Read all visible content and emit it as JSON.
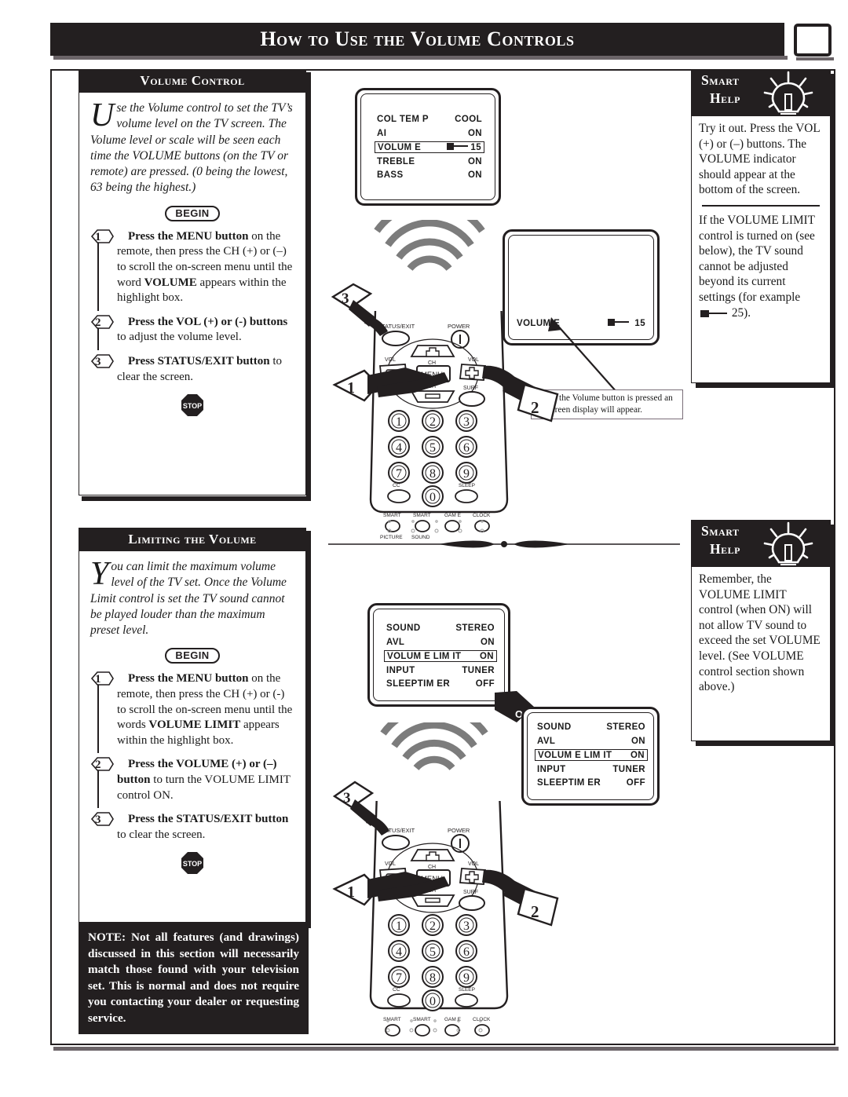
{
  "page": {
    "title": "How to Use the Volume Controls",
    "corner_icon": "tv-icon"
  },
  "volume_control": {
    "heading": "Volume Control",
    "dropcap": "U",
    "intro": "se the Volume control to set the TV’s volume level on the TV screen. The Volume level or scale will be seen each time the VOLUME buttons (on the TV or remote) are pressed.  (0 being the lowest, 63 being the highest.)",
    "begin_label": "BEGIN",
    "stop_label": "STOP",
    "steps": [
      {
        "num": "1",
        "bold": "Press the MENU button",
        "rest": " on the remote, then press the CH (+) or (–) to scroll the on-screen menu until the word ",
        "bold2": "VOLUME",
        "rest2": " appears within the highlight box."
      },
      {
        "num": "2",
        "bold": "Press the VOL (+) or (-) buttons",
        "rest": " to adjust the volume level.",
        "bold2": "",
        "rest2": ""
      },
      {
        "num": "3",
        "bold": "Press STATUS/EXIT button",
        "rest": " to clear the screen.",
        "bold2": "",
        "rest2": ""
      }
    ]
  },
  "limiting_volume": {
    "heading": "Limiting the Volume",
    "dropcap": "Y",
    "intro": "ou can limit the maximum volume level of the TV set. Once the Volume Limit control is set the TV sound cannot be played louder than the maximum preset level.",
    "begin_label": "BEGIN",
    "stop_label": "STOP",
    "steps": [
      {
        "num": "1",
        "bold": "Press the MENU button",
        "rest": " on the remote, then press the CH (+) or (-) to scroll the on-screen menu until the words ",
        "bold2": "VOLUME LIMIT",
        "rest2": " appears within the highlight box."
      },
      {
        "num": "2",
        "bold": "Press the VOLUME (+) or (–) button",
        "rest": " to turn the VOLUME LIMIT control ON.",
        "bold2": "",
        "rest2": ""
      },
      {
        "num": "3",
        "bold": "Press the STATUS/EXIT button",
        "rest": " to clear the screen.",
        "bold2": "",
        "rest2": ""
      }
    ]
  },
  "note": {
    "text": "NOTE: Not all features (and  drawings) discussed in this section will necessarily match those found with your television set. This is normal and does not require you contacting your dealer or requesting service."
  },
  "smart_help_1": {
    "word1": "Smart",
    "word2": "Help",
    "icon": "lightbulb-icon",
    "para1": "Try it out. Press the VOL (+) or (–) buttons. The VOLUME indicator should appear at the bottom of the screen.",
    "para2_a": "If the VOLUME LIMIT control is turned on (see below), the TV sound cannot be adjusted beyond its current settings (for example ",
    "para2_b": " 25)."
  },
  "smart_help_2": {
    "word1": "Smart",
    "word2": "Help",
    "icon": "lightbulb-icon",
    "para1": "Remember, the VOLUME LIMIT control (when ON) will not allow TV sound to exceed the set VOLUME level. (See VOLUME control section shown above.)"
  },
  "tv_menu_1": {
    "rows": [
      {
        "label": "COL TEM P",
        "value": "COOL",
        "highlighted": false,
        "meter": false
      },
      {
        "label": "AI",
        "value": "ON",
        "highlighted": false,
        "meter": false
      },
      {
        "label": "VOLUM E",
        "value": "15",
        "highlighted": true,
        "meter": true
      },
      {
        "label": "TREBLE",
        "value": "ON",
        "highlighted": false,
        "meter": false
      },
      {
        "label": "BASS",
        "value": "ON",
        "highlighted": false,
        "meter": false
      }
    ]
  },
  "tv_osd_2": {
    "label": "VOLUM E",
    "value": "15",
    "meter": true
  },
  "tv_menu_3": {
    "rows": [
      {
        "label": "SOUND",
        "value": "STEREO",
        "highlighted": false,
        "meter": false
      },
      {
        "label": "AVL",
        "value": "ON",
        "highlighted": false,
        "meter": false
      },
      {
        "label": "VOLUM E LIM IT",
        "value": "ON",
        "highlighted": true,
        "meter": false
      },
      {
        "label": "INPUT",
        "value": "TUNER",
        "highlighted": false,
        "meter": false
      },
      {
        "label": "SLEEPTIM ER",
        "value": "OFF",
        "highlighted": false,
        "meter": false
      }
    ]
  },
  "tv_menu_4": {
    "rows": [
      {
        "label": "SOUND",
        "value": "STEREO",
        "highlighted": false,
        "meter": false
      },
      {
        "label": "AVL",
        "value": "ON",
        "highlighted": false,
        "meter": false
      },
      {
        "label": "VOLUM E LIM IT",
        "value": "ON",
        "highlighted": true,
        "meter": false
      },
      {
        "label": "INPUT",
        "value": "TUNER",
        "highlighted": false,
        "meter": false
      },
      {
        "label": "SLEEPTIM ER",
        "value": "OFF",
        "highlighted": false,
        "meter": false
      }
    ]
  },
  "osd_callout": {
    "text": "When the Volume button is pressed an on-screen display will appear."
  },
  "or_flag": {
    "label": "OR"
  },
  "remote": {
    "labels": {
      "status_exit": "TATUS/EXIT",
      "power": "POWER",
      "vol_left": "VOL",
      "vol_right": "VOL",
      "menu": "MENU",
      "ch_up": "CH",
      "ch_down": "CH",
      "surf": "SURF",
      "cc": "CC",
      "sleep": "SLEEP",
      "smart1": "SMART",
      "smart2": "SMART",
      "game": "GAM E",
      "clock": "CLOCK",
      "picture": "PICTURE",
      "sound": "SOUND"
    },
    "keys": [
      "1",
      "2",
      "3",
      "4",
      "5",
      "6",
      "7",
      "8",
      "9",
      "0"
    ],
    "callouts": [
      "1",
      "2",
      "3"
    ]
  },
  "colors": {
    "ink": "#231f20",
    "paper": "#ffffff",
    "wave_gray": "#7c7c7c",
    "shadow_gray": "#6b6468"
  }
}
